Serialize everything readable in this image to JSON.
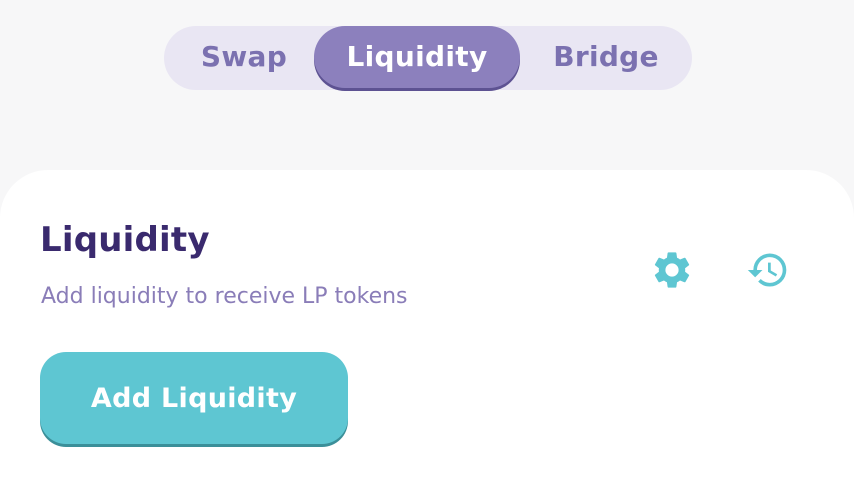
{
  "tabs": [
    {
      "label": "Swap",
      "active": false
    },
    {
      "label": "Liquidity",
      "active": true
    },
    {
      "label": "Bridge",
      "active": false
    }
  ],
  "card": {
    "title": "Liquidity",
    "subtitle": "Add liquidity to receive LP tokens",
    "settings_icon": "gear-icon",
    "history_icon": "history-icon",
    "add_button_label": "Add Liquidity"
  },
  "colors": {
    "background": "#f7f7f8",
    "tab_track": "#e9e6f3",
    "tab_active": "#8c80bd",
    "tab_inactive_text": "#7b71b0",
    "title": "#3a2a6e",
    "subtitle": "#8a7db8",
    "accent": "#5ec6d2"
  }
}
